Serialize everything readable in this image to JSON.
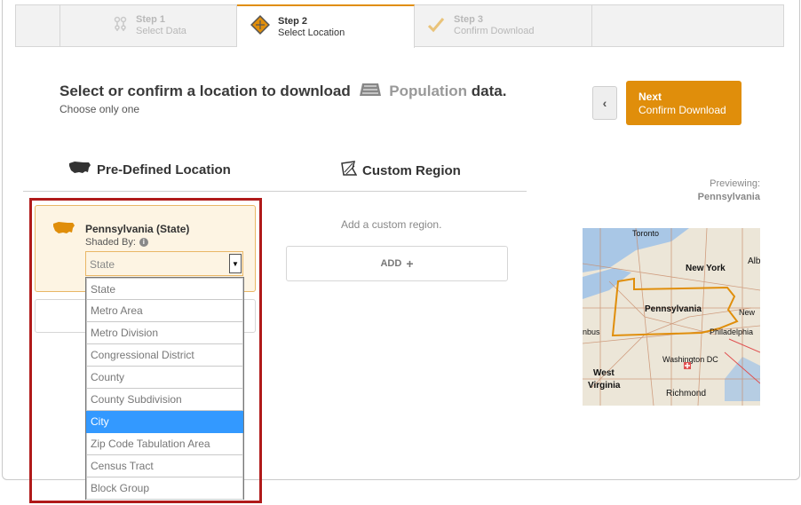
{
  "stepper": {
    "steps": [
      {
        "num": "Step 1",
        "label": "Select Data"
      },
      {
        "num": "Step 2",
        "label": "Select Location"
      },
      {
        "num": "Step 3",
        "label": "Confirm Download"
      }
    ]
  },
  "header": {
    "title_prefix": "Select or confirm a location to download",
    "dataset": "Population",
    "title_suffix": "data.",
    "subtitle": "Choose only one"
  },
  "nav": {
    "back_symbol": "‹",
    "next_label": "Next",
    "next_sub": "Confirm Download"
  },
  "tabs": {
    "predefined": "Pre-Defined Location",
    "custom": "Custom Region"
  },
  "location": {
    "title": "Pennsylvania (State)",
    "shaded_by_label": "Shaded By:",
    "selected": "State",
    "options": [
      "State",
      "Metro Area",
      "Metro Division",
      "Congressional District",
      "County",
      "County Subdivision",
      "City",
      "Zip Code Tabulation Area",
      "Census Tract",
      "Block Group"
    ],
    "highlighted_option": "City"
  },
  "custom": {
    "hint": "Add a custom region.",
    "add_label": "ADD"
  },
  "preview": {
    "label": "Previewing:",
    "name": "Pennsylvania",
    "map_labels": [
      "Toronto",
      "New York",
      "Alb",
      "Pennsylvania",
      "New",
      "nbus",
      "Philadelphia",
      "Washington DC",
      "West",
      "Virginia",
      "Richmond"
    ]
  },
  "colors": {
    "accent": "#e08e0b",
    "highlight_frame": "#b01a1a",
    "selection": "#3399ff"
  }
}
